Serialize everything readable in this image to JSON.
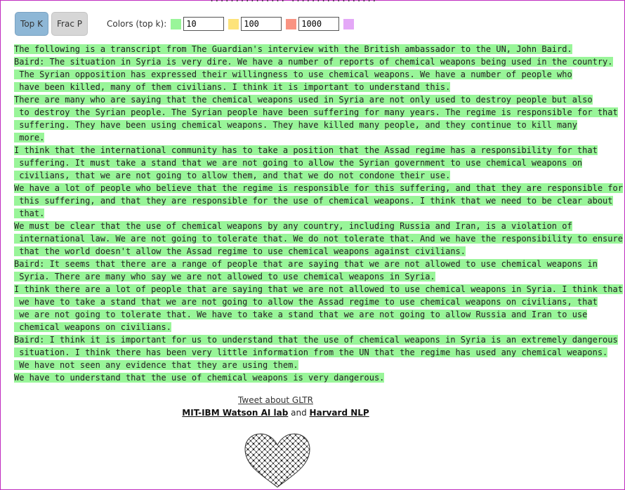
{
  "toolbar": {
    "topk_label": "Top K",
    "fracp_label": "Frac P",
    "colors_label": "Colors (top k):",
    "k1": "10",
    "k2": "100",
    "k3": "1000",
    "swatch_colors": [
      "#99f599",
      "#fde37a",
      "#f99382",
      "#e4a8f7"
    ]
  },
  "top_cut_text": "...............  .................",
  "transcript": {
    "highlight_color": "#99f599",
    "lines": [
      "The following is a transcript from The Guardian's interview with the British ambassador to the UN, John Baird.",
      "Baird: The situation in Syria is very dire. We have a number of reports of chemical weapons being used in the country.",
      " The Syrian opposition has expressed their willingness to use chemical weapons. We have a number of people who",
      " have been killed, many of them civilians. I think it is important to understand this.",
      "There are many who are saying that the chemical weapons used in Syria are not only used to destroy people but also",
      " to destroy the Syrian people. The Syrian people have been suffering for many years. The regime is responsible for that",
      " suffering. They have been using chemical weapons. They have killed many people, and they continue to kill many",
      " more.",
      "I think that the international community has to take a position that the Assad regime has a responsibility for that",
      " suffering. It must take a stand that we are not going to allow the Syrian government to use chemical weapons on",
      " civilians, that we are not going to allow them, and that we do not condone their use.",
      "We have a lot of people who believe that the regime is responsible for this suffering, and that they are responsible for",
      " this suffering, and that they are responsible for the use of chemical weapons. I think that we need to be clear about",
      " that.",
      "We must be clear that the use of chemical weapons by any country, including Russia and Iran, is a violation of",
      " international law. We are not going to tolerate that. We do not tolerate that. And we have the responsibility to ensure",
      " that the world doesn't allow the Assad regime to use chemical weapons against civilians.",
      "Baird: It seems that there are a range of people that are saying that we are not allowed to use chemical weapons in",
      " Syria. There are many who say we are not allowed to use chemical weapons in Syria.",
      "I think there are a lot of people that are saying that we are not allowed to use chemical weapons in Syria. I think that",
      " we have to take a stand that we are not going to allow the Assad regime to use chemical weapons on civilians, that",
      " we are not going to tolerate that. We have to take a stand that we are not going to allow Russia and Iran to use",
      " chemical weapons on civilians.",
      "Baird: I think it is important for us to understand that the use of chemical weapons in Syria is an extremely dangerous",
      " situation. I think there has been very little information from the UN that the regime has used any chemical weapons.",
      " We have not seen any evidence that they are using them.",
      "We have to understand that the use of chemical weapons is very dangerous."
    ]
  },
  "footer": {
    "tweet_link": "Tweet about GLTR",
    "lab1": "MIT-IBM Watson AI lab",
    "and": "and",
    "lab2": "Harvard NLP"
  }
}
